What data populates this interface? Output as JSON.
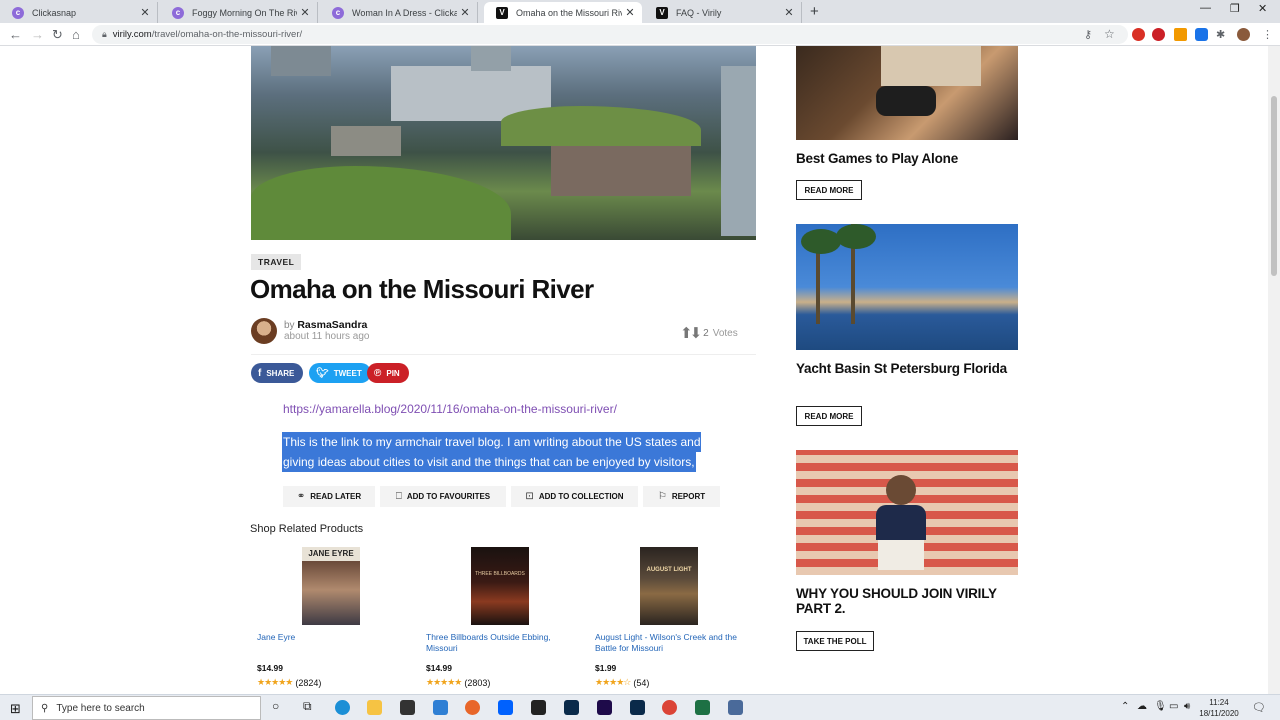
{
  "tabs": [
    {
      "label": "Clickasnap",
      "favicon": "clickasnap-icon"
    },
    {
      "label": "Foggy Morning On The River. - C",
      "favicon": "clickasnap-icon"
    },
    {
      "label": "Woman In A Dress - Clickasnap",
      "favicon": "clickasnap-icon"
    },
    {
      "label": "Omaha on the Missouri River - Vi",
      "favicon": "virily-icon"
    },
    {
      "label": "FAQ - Virily",
      "favicon": "virily-icon"
    }
  ],
  "address": {
    "host": "virily.com",
    "path": "/travel/omaha-on-the-missouri-river/"
  },
  "article": {
    "category": "TRAVEL",
    "title": "Omaha on the Missouri River",
    "by": "by",
    "author": "RasmaSandra",
    "time": "about 11 hours ago",
    "votes_count": "2",
    "votes_label": "Votes",
    "share": {
      "facebook": "SHARE",
      "twitter": "TWEET",
      "pinterest": "PIN"
    },
    "link": "https://yamarella.blog/2020/11/16/omaha-on-the-missouri-river/",
    "selected_lines": [
      "This is the link to my armchair travel blog. I am writing about the US states and",
      "giving ideas about cities to visit and the things that can be enjoyed by visitors,"
    ],
    "actions": {
      "read_later": "READ LATER",
      "favourites": "ADD TO FAVOURITES",
      "collection": "ADD TO COLLECTION",
      "report": "REPORT"
    }
  },
  "shop": {
    "heading": "Shop Related Products",
    "products": [
      {
        "name": "Jane Eyre",
        "price": "$14.99",
        "stars": "★★★★★",
        "reviews": "(2824)",
        "cover_text": "JANE EYRE"
      },
      {
        "name": "Three Billboards Outside Ebbing, Missouri",
        "price": "$14.99",
        "stars": "★★★★★",
        "reviews": "(2803)",
        "cover_text": "THREE BILLBOARDS"
      },
      {
        "name": "August Light - Wilson's Creek and the Battle for Missouri",
        "price": "$1.99",
        "stars": "★★★★☆",
        "reviews": "(54)",
        "cover_text": "AUGUST LIGHT"
      }
    ]
  },
  "sidebar": {
    "cards": [
      {
        "title": "Best Games to Play Alone",
        "button": "READ MORE"
      },
      {
        "title": "Yacht Basin St Petersburg Florida",
        "button": "READ MORE"
      },
      {
        "title": "WHY YOU SHOULD JOIN VIRILY PART 2.",
        "button": "TAKE THE POLL"
      }
    ]
  },
  "taskbar": {
    "search_placeholder": "Type here to search",
    "time": "11:24",
    "date": "18/11/2020"
  },
  "colors": {
    "facebook": "#3b5998",
    "twitter": "#1da1f2",
    "pinterest": "#cb2027",
    "selection": "#3b78d8",
    "link": "#7f4fb3"
  }
}
